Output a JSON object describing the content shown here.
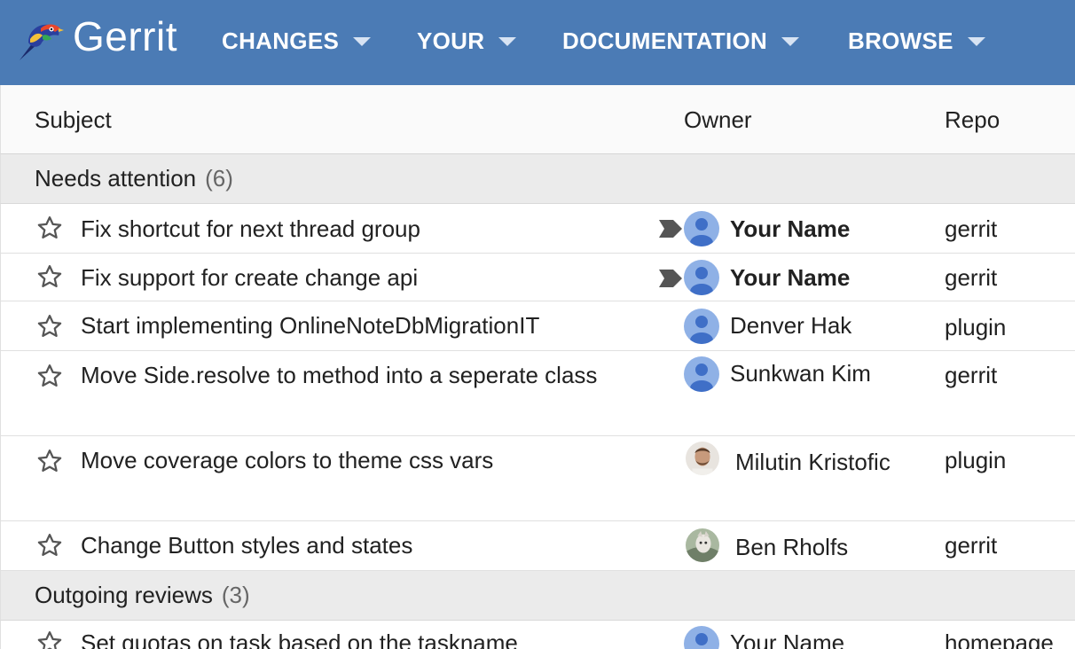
{
  "header": {
    "brand": "Gerrit",
    "nav": [
      {
        "label": "CHANGES"
      },
      {
        "label": "YOUR"
      },
      {
        "label": "DOCUMENTATION"
      },
      {
        "label": "BROWSE"
      }
    ]
  },
  "table": {
    "columns": [
      "Subject",
      "Owner",
      "Repo"
    ],
    "sections": [
      {
        "title": "Needs attention",
        "count": "(6)"
      },
      {
        "title": "Outgoing reviews",
        "count": "(3)"
      }
    ],
    "rows": [
      {
        "subject": "Fix shortcut for next thread group",
        "owner": "Your Name",
        "repo": "gerrit",
        "avatar": "default-avatar",
        "attention": true,
        "owner_bold": true
      },
      {
        "subject": "Fix support for create change api",
        "owner": "Your Name",
        "repo": "gerrit",
        "avatar": "default-avatar",
        "attention": true,
        "owner_bold": true
      },
      {
        "subject": "Start implementing OnlineNoteDbMigrationIT",
        "owner": "Denver Hak",
        "repo": "plugin",
        "avatar": "default-avatar",
        "attention": false,
        "owner_bold": false
      },
      {
        "subject": "Move Side.resolve to method into a seperate class",
        "owner": "Sunkwan Kim",
        "repo": "gerrit",
        "avatar": "default-avatar",
        "attention": false,
        "owner_bold": false
      },
      {
        "subject": "Move coverage colors to theme css vars",
        "owner": "Milutin Kristofic",
        "repo": "plugin",
        "avatar": "photo-avatar",
        "attention": false,
        "owner_bold": false
      },
      {
        "subject": "Change Button styles and states",
        "owner": "Ben Rholfs",
        "repo": "gerrit",
        "avatar": "photo-avatar",
        "attention": false,
        "owner_bold": false
      },
      {
        "subject": "Set quotas on task based on the taskname",
        "owner": "Your Name",
        "repo": "homepage",
        "avatar": "default-avatar",
        "attention": false,
        "owner_bold": false
      }
    ]
  },
  "colors": {
    "header_bg": "#4b7bb5",
    "section_bg": "#ebebeb",
    "avatar_default": "#8fb1e6",
    "avatar_figure": "#3f6fc7",
    "attention_marker": "#555555"
  },
  "icons": {
    "logo": "gerrit-bird-logo",
    "star": "star-outline-icon",
    "caret": "dropdown-caret-icon",
    "attention": "attention-marker-icon"
  }
}
